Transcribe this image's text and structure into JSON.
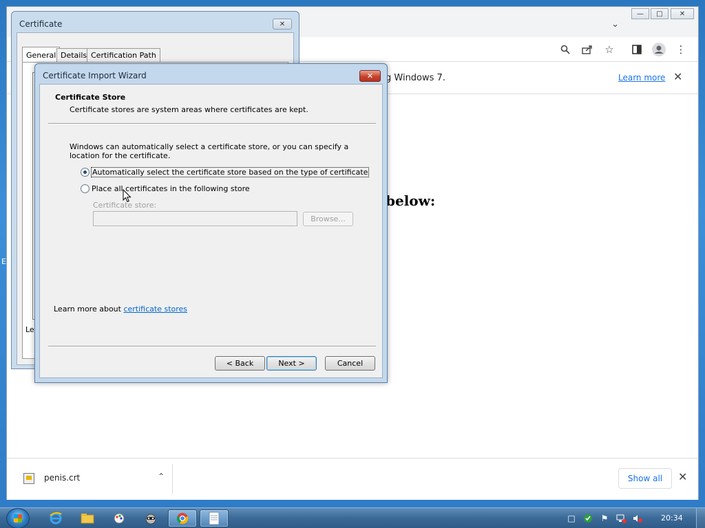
{
  "chrome": {
    "infobar_text": "g Windows 7.",
    "learn_more": "Learn more",
    "page_heading": "below:",
    "download": {
      "filename": "penis.crt",
      "show_all": "Show all"
    }
  },
  "cert_dialog": {
    "title": "Certificate",
    "tabs": [
      "General",
      "Details",
      "Certification Path"
    ],
    "learn_text": "Le"
  },
  "wizard": {
    "title": "Certificate Import Wizard",
    "heading": "Certificate Store",
    "subheading": "Certificate stores are system areas where certificates are kept.",
    "description": "Windows can automatically select a certificate store, or you can specify a location for the certificate.",
    "radio_auto": "Automatically select the certificate store based on the type of certificate",
    "radio_manual": "Place all certificates in the following store",
    "store_label": "Certificate store:",
    "store_value": "",
    "browse": "Browse...",
    "learn_prefix": "Learn more about ",
    "learn_link": "certificate stores",
    "back": "< Back",
    "next": "Next >",
    "cancel": "Cancel"
  },
  "desktop": {
    "edge_fragment": "E"
  },
  "taskbar": {
    "clock": "20:34",
    "apps": [
      "internet-explorer",
      "windows-explorer",
      "paint",
      "raccoon-app",
      "chrome",
      "notepad"
    ]
  },
  "colors": {
    "link_blue": "#1a73e8",
    "wizard_frame": "#c3d8ec",
    "taskbar": "#3c6a98"
  }
}
